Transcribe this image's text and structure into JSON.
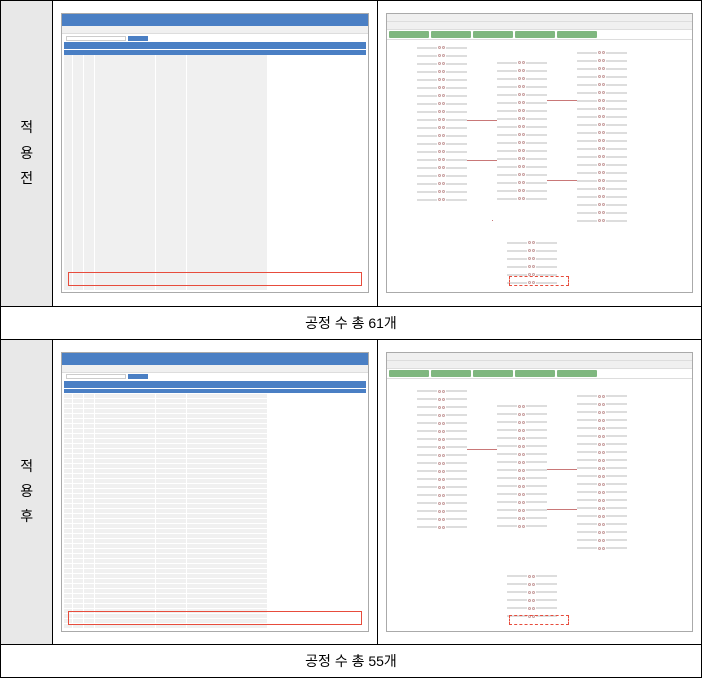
{
  "rows": [
    {
      "label": "적용전",
      "caption": "공정 수 총 61개"
    },
    {
      "label": "적용후",
      "caption": "공정 수 총 55개"
    }
  ]
}
